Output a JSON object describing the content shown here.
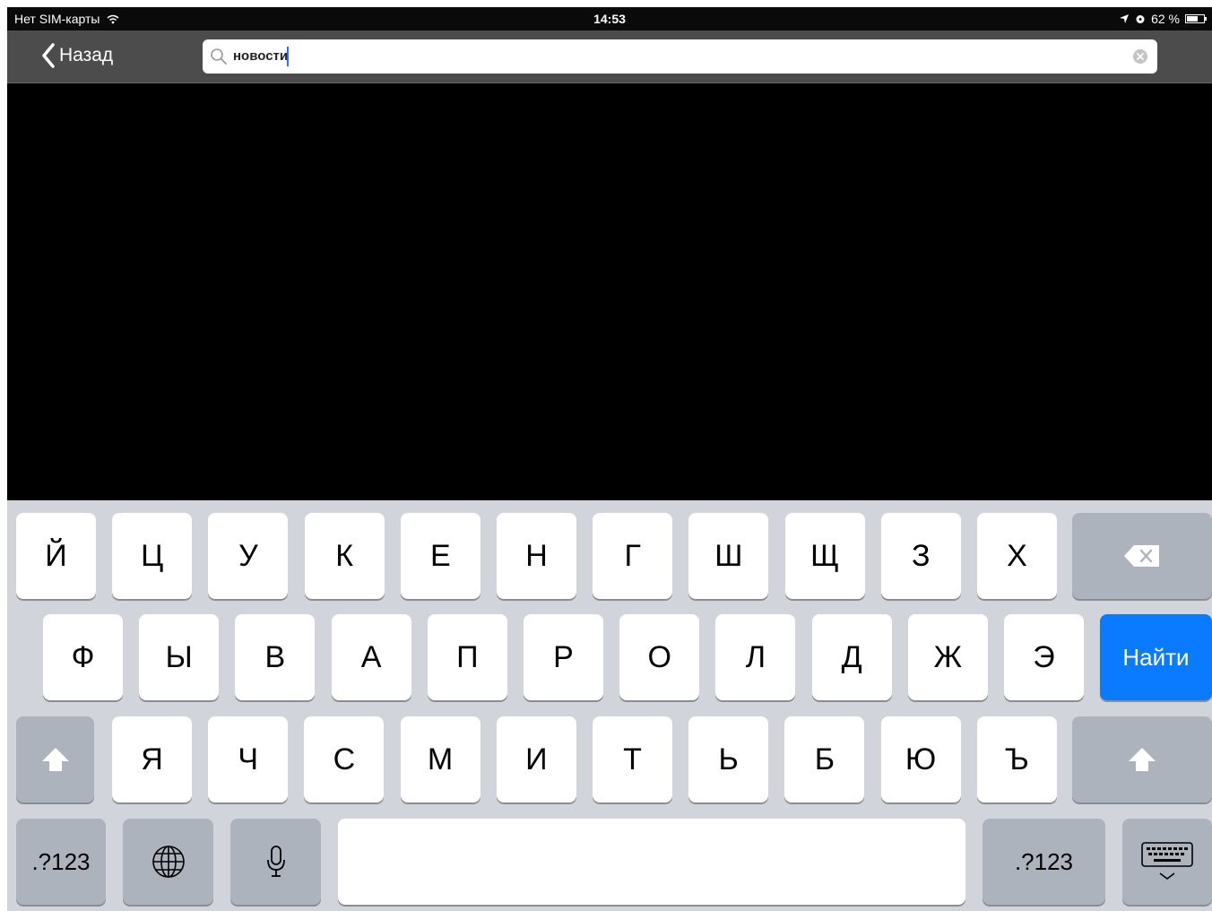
{
  "status_bar": {
    "carrier": "Нет SIM-карты",
    "time": "14:53",
    "battery": "62 %"
  },
  "nav": {
    "back_label": "Назад"
  },
  "search": {
    "value": "новости"
  },
  "keyboard": {
    "row1": [
      "Й",
      "Ц",
      "У",
      "К",
      "Е",
      "Н",
      "Г",
      "Ш",
      "Щ",
      "З",
      "Х"
    ],
    "row2": [
      "Ф",
      "Ы",
      "В",
      "А",
      "П",
      "Р",
      "О",
      "Л",
      "Д",
      "Ж",
      "Э"
    ],
    "row3": [
      "Я",
      "Ч",
      "С",
      "М",
      "И",
      "Т",
      "Ь",
      "Б",
      "Ю",
      "Ъ"
    ],
    "submit_label": "Найти",
    "numbers_label": ".?123",
    "accent_color": "#0a7bff"
  },
  "icons": [
    "chevron-left-icon",
    "search-icon",
    "clear-icon",
    "backspace-icon",
    "shift-icon",
    "globe-icon",
    "microphone-icon",
    "keyboard-dismiss-icon",
    "wifi-icon",
    "location-icon",
    "battery-icon"
  ]
}
